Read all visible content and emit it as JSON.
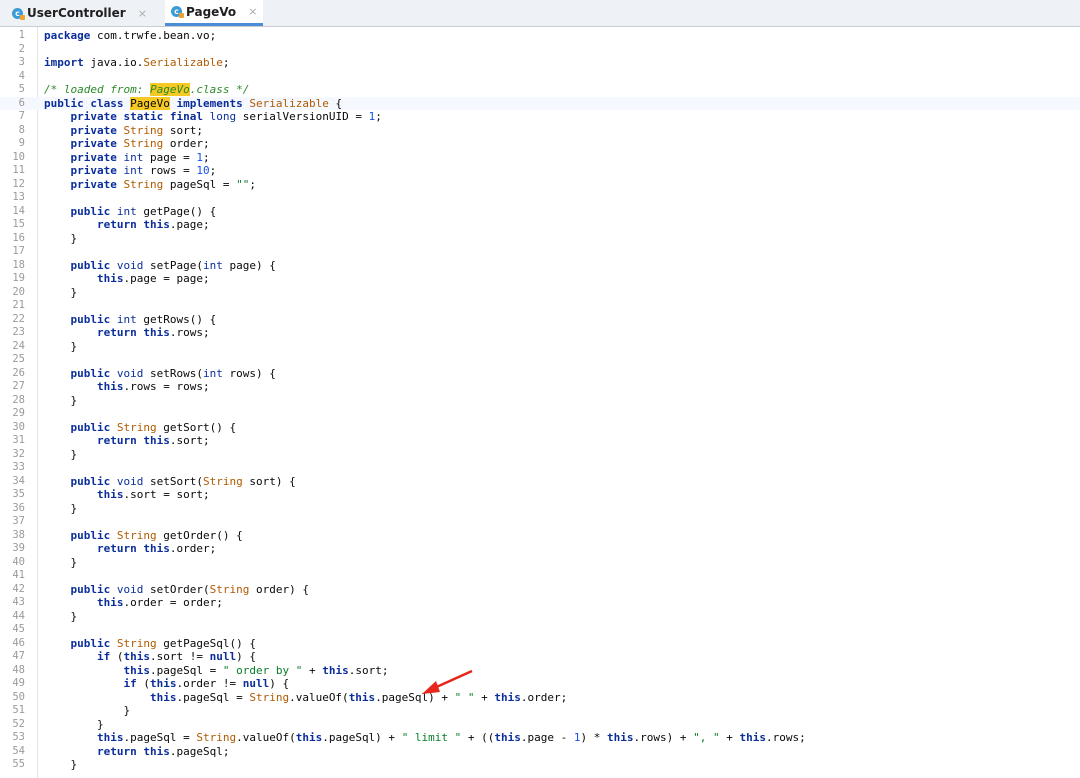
{
  "tabs": [
    {
      "label": "UserController",
      "active": false
    },
    {
      "label": "PageVo",
      "active": true
    }
  ],
  "tab_close_glyph": "×",
  "code_lines": [
    {
      "n": "1",
      "text": "package com.trwfe.bean.vo;"
    },
    {
      "n": "2",
      "text": ""
    },
    {
      "n": "3",
      "text": "import java.io.Serializable;"
    },
    {
      "n": "4",
      "text": ""
    },
    {
      "n": "5",
      "text": "/* loaded from: PageVo.class */"
    },
    {
      "n": "6",
      "text": "public class PageVo implements Serializable {"
    },
    {
      "n": "7",
      "text": "    private static final long serialVersionUID = 1;"
    },
    {
      "n": "8",
      "text": "    private String sort;"
    },
    {
      "n": "9",
      "text": "    private String order;"
    },
    {
      "n": "10",
      "text": "    private int page = 1;"
    },
    {
      "n": "11",
      "text": "    private int rows = 10;"
    },
    {
      "n": "12",
      "text": "    private String pageSql = \"\";"
    },
    {
      "n": "13",
      "text": ""
    },
    {
      "n": "14",
      "text": "    public int getPage() {"
    },
    {
      "n": "15",
      "text": "        return this.page;"
    },
    {
      "n": "16",
      "text": "    }"
    },
    {
      "n": "17",
      "text": ""
    },
    {
      "n": "18",
      "text": "    public void setPage(int page) {"
    },
    {
      "n": "19",
      "text": "        this.page = page;"
    },
    {
      "n": "20",
      "text": "    }"
    },
    {
      "n": "21",
      "text": ""
    },
    {
      "n": "22",
      "text": "    public int getRows() {"
    },
    {
      "n": "23",
      "text": "        return this.rows;"
    },
    {
      "n": "24",
      "text": "    }"
    },
    {
      "n": "25",
      "text": ""
    },
    {
      "n": "26",
      "text": "    public void setRows(int rows) {"
    },
    {
      "n": "27",
      "text": "        this.rows = rows;"
    },
    {
      "n": "28",
      "text": "    }"
    },
    {
      "n": "29",
      "text": ""
    },
    {
      "n": "30",
      "text": "    public String getSort() {"
    },
    {
      "n": "31",
      "text": "        return this.sort;"
    },
    {
      "n": "32",
      "text": "    }"
    },
    {
      "n": "33",
      "text": ""
    },
    {
      "n": "34",
      "text": "    public void setSort(String sort) {"
    },
    {
      "n": "35",
      "text": "        this.sort = sort;"
    },
    {
      "n": "36",
      "text": "    }"
    },
    {
      "n": "37",
      "text": ""
    },
    {
      "n": "38",
      "text": "    public String getOrder() {"
    },
    {
      "n": "39",
      "text": "        return this.order;"
    },
    {
      "n": "40",
      "text": "    }"
    },
    {
      "n": "41",
      "text": ""
    },
    {
      "n": "42",
      "text": "    public void setOrder(String order) {"
    },
    {
      "n": "43",
      "text": "        this.order = order;"
    },
    {
      "n": "44",
      "text": "    }"
    },
    {
      "n": "45",
      "text": ""
    },
    {
      "n": "46",
      "text": "    public String getPageSql() {"
    },
    {
      "n": "47",
      "text": "        if (this.sort != null) {"
    },
    {
      "n": "48",
      "text": "            this.pageSql = \" order by \" + this.sort;"
    },
    {
      "n": "49",
      "text": "            if (this.order != null) {"
    },
    {
      "n": "50",
      "text": "                this.pageSql = String.valueOf(this.pageSql) + \" \" + this.order;"
    },
    {
      "n": "51",
      "text": "            }"
    },
    {
      "n": "52",
      "text": "        }"
    },
    {
      "n": "53",
      "text": "        this.pageSql = String.valueOf(this.pageSql) + \" limit \" + ((this.page - 1) * this.rows) + \", \" + this.rows;"
    },
    {
      "n": "54",
      "text": "        return this.pageSql;"
    },
    {
      "n": "55",
      "text": "    }"
    }
  ],
  "highlight_word": "PageVo",
  "current_line": "6",
  "colors": {
    "keyword": "#0b2e9b",
    "string": "#087d2a",
    "number": "#1750eb",
    "comment": "#2a8a2a",
    "highlight": "#f6c924",
    "arrow": "#e8251b"
  }
}
